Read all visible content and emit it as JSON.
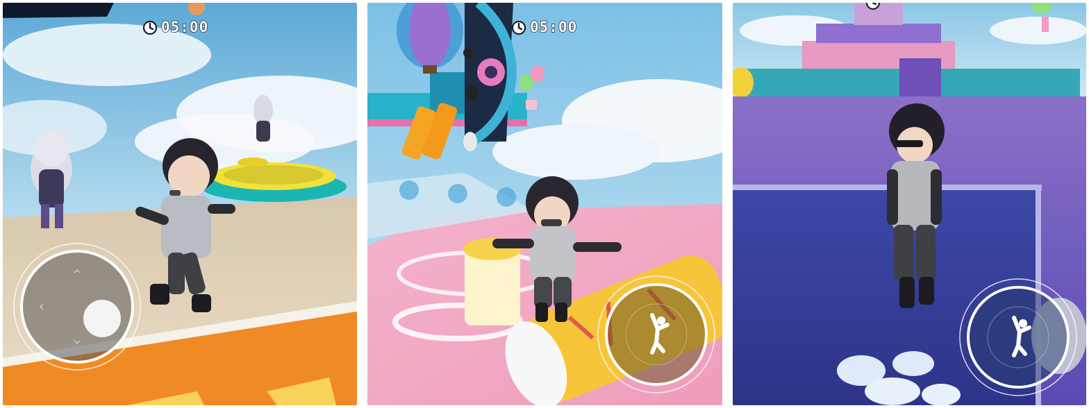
{
  "panels": [
    {
      "id": "panel-1",
      "timer": {
        "icon": "stopwatch-icon",
        "text": "05:00"
      },
      "control": "virtual-joystick"
    },
    {
      "id": "panel-2",
      "timer": {
        "icon": "stopwatch-icon",
        "text": "05:00"
      },
      "control": "jump-button",
      "jump_icon": "jump-figure-icon"
    },
    {
      "id": "panel-3",
      "timer": {
        "icon": "stopwatch-icon",
        "text": ""
      },
      "control": "jump-button",
      "jump_icon": "jump-figure-icon"
    }
  ],
  "colors": {
    "timer_text": "#ffffff",
    "timer_outline": "#1e1e26",
    "control_ring": "#ffffff",
    "sky": "#bfe1f1",
    "floor_orange": "#f08a24",
    "floor_pink": "#f2a9c6",
    "wall_purple": "#7b6cc4"
  }
}
